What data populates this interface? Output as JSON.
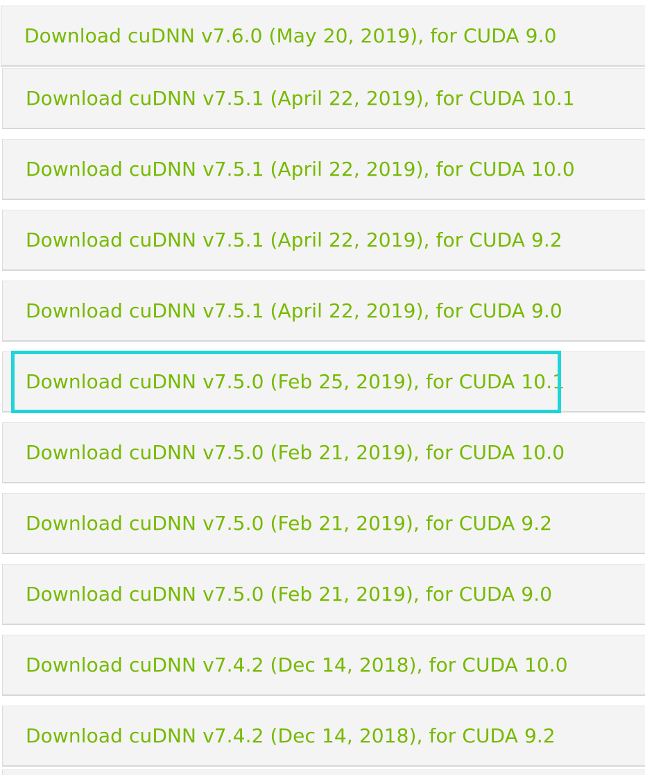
{
  "downloads": {
    "items": [
      {
        "label": "Download cuDNN v7.6.0 (May 20, 2019), for CUDA 9.0"
      },
      {
        "label": "Download cuDNN v7.5.1 (April 22, 2019), for CUDA 10.1"
      },
      {
        "label": "Download cuDNN v7.5.1 (April 22, 2019), for CUDA 10.0"
      },
      {
        "label": "Download cuDNN v7.5.1 (April 22, 2019), for CUDA 9.2"
      },
      {
        "label": "Download cuDNN v7.5.1 (April 22, 2019), for CUDA 9.0"
      },
      {
        "label": "Download cuDNN v7.5.0 (Feb 25, 2019), for CUDA 10.1"
      },
      {
        "label": "Download cuDNN v7.5.0 (Feb 21, 2019), for CUDA 10.0"
      },
      {
        "label": "Download cuDNN v7.5.0 (Feb 21, 2019), for CUDA 9.2"
      },
      {
        "label": "Download cuDNN v7.5.0 (Feb 21, 2019), for CUDA 9.0"
      },
      {
        "label": "Download cuDNN v7.4.2 (Dec 14, 2018), for CUDA 10.0"
      },
      {
        "label": "Download cuDNN v7.4.2 (Dec 14, 2018), for CUDA 9.2"
      }
    ]
  },
  "colors": {
    "link": "#76b900",
    "row_background": "#f4f4f4",
    "highlight": "#1fd5d9"
  }
}
